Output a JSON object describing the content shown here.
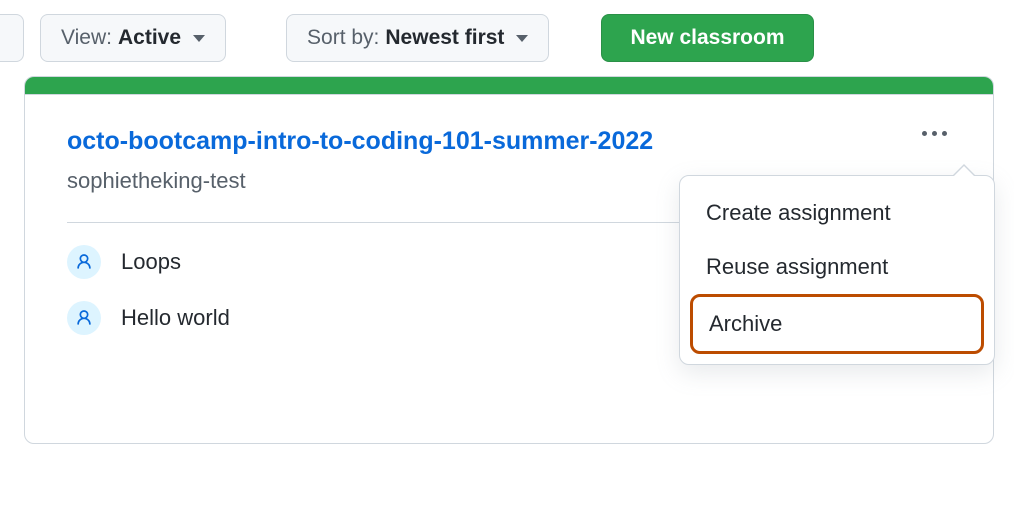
{
  "toolbar": {
    "view": {
      "prefix": "View: ",
      "value": "Active"
    },
    "sort": {
      "prefix": "Sort by: ",
      "value": "Newest first"
    },
    "new_classroom_label": "New classroom"
  },
  "classroom": {
    "title": "octo-bootcamp-intro-to-coding-101-summer-2022",
    "org": "sophietheking-test",
    "assignments": [
      {
        "name": "Loops"
      },
      {
        "name": "Hello world"
      }
    ]
  },
  "menu": {
    "items": [
      {
        "label": "Create assignment",
        "highlight": false
      },
      {
        "label": "Reuse assignment",
        "highlight": false
      },
      {
        "label": "Archive",
        "highlight": true
      }
    ]
  },
  "colors": {
    "primary_green": "#2da44e",
    "link_blue": "#0969da",
    "highlight_orange": "#bc4c00"
  }
}
